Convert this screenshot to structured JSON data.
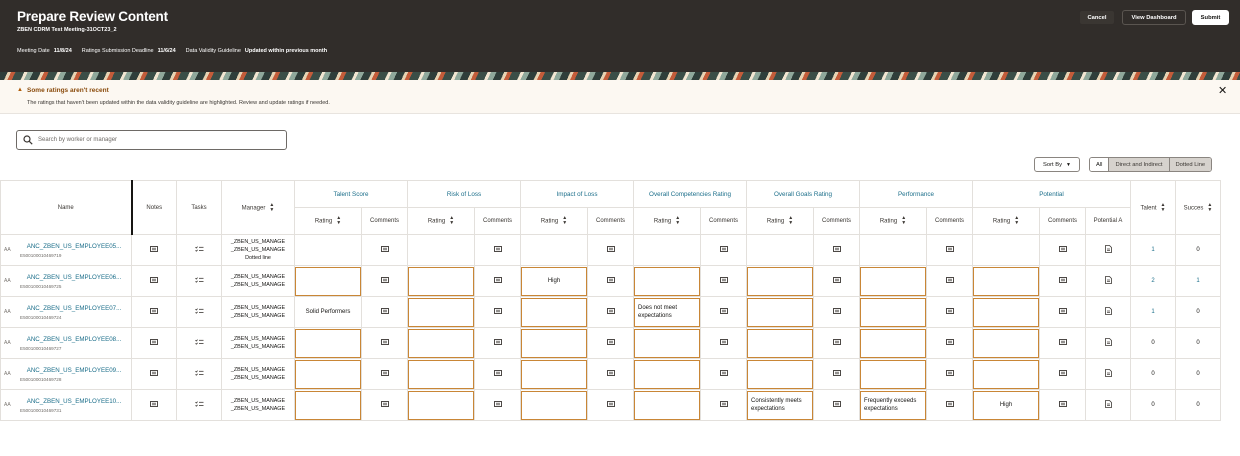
{
  "header": {
    "title": "Prepare Review Content",
    "subtitle": "ZBEN CDRM Test Meeting-31OCT23_2",
    "meeting_date_label": "Meeting Date",
    "meeting_date": "11/8/24",
    "deadline_label": "Ratings Submission Deadline",
    "deadline": "11/6/24",
    "validity_label": "Data Validity Guideline",
    "validity": "Updated within previous month",
    "cancel_label": "Cancel",
    "dashboard_label": "View Dashboard",
    "submit_label": "Submit"
  },
  "alert": {
    "title": "Some ratings aren't recent",
    "message": "The ratings that haven't been updated within the data validity guideline are highlighted. Review and update ratings if needed."
  },
  "search": {
    "placeholder": "Search by worker or manager"
  },
  "toolbar": {
    "sort_label": "Sort By",
    "filters": [
      "All",
      "Direct and Indirect",
      "Dotted Line"
    ]
  },
  "columns": {
    "name": "Name",
    "notes": "Notes",
    "tasks": "Tasks",
    "manager": "Manager",
    "groups": [
      "Talent Score",
      "Risk of Loss",
      "Impact of Loss",
      "Overall Competencies Rating",
      "Overall Goals Rating",
      "Performance",
      "Potential"
    ],
    "rating": "Rating",
    "comments": "Comments",
    "potential_a": "Potential A",
    "talent": "Talent",
    "success": "Succes"
  },
  "rows": [
    {
      "aa": "AA",
      "name": "ANC_ZBEN_US_EMPLOYEE05...",
      "id": "E50010001046​9719",
      "mgr1": "_ZBEN_US_MANAGE",
      "mgr2": "_ZBEN_US_MANAGE",
      "mgr3": "Dotted line",
      "ratings": [
        "",
        "",
        "",
        "",
        "",
        "",
        ""
      ],
      "flag": [
        false,
        false,
        false,
        false,
        false,
        false,
        false
      ],
      "talent": "1",
      "success": "0"
    },
    {
      "aa": "AA",
      "name": "ANC_ZBEN_US_EMPLOYEE06...",
      "id": "E500100010469725",
      "mgr1": "_ZBEN_US_MANAGE",
      "mgr2": "_ZBEN_US_MANAGE",
      "mgr3": "",
      "ratings": [
        "",
        "",
        "High",
        "",
        "",
        "",
        ""
      ],
      "flag": [
        true,
        true,
        true,
        true,
        true,
        true,
        true
      ],
      "talent": "2",
      "success": "1"
    },
    {
      "aa": "AA",
      "name": "ANC_ZBEN_US_EMPLOYEE07...",
      "id": "E500100010469724",
      "mgr1": "_ZBEN_US_MANAGE",
      "mgr2": "_ZBEN_US_MANAGE",
      "mgr3": "",
      "ratings": [
        "Solid Performers",
        "",
        "",
        "Does not meet expectations",
        "",
        "",
        ""
      ],
      "flag": [
        false,
        true,
        true,
        true,
        true,
        true,
        true
      ],
      "talent": "1",
      "success": "0"
    },
    {
      "aa": "AA",
      "name": "ANC_ZBEN_US_EMPLOYEE08...",
      "id": "E500100010469727",
      "mgr1": "_ZBEN_US_MANAGE",
      "mgr2": "_ZBEN_US_MANAGE",
      "mgr3": "",
      "ratings": [
        "",
        "",
        "",
        "",
        "",
        "",
        ""
      ],
      "flag": [
        true,
        true,
        true,
        true,
        true,
        true,
        true
      ],
      "talent": "0",
      "success": "0"
    },
    {
      "aa": "AA",
      "name": "ANC_ZBEN_US_EMPLOYEE09...",
      "id": "E500100010469728",
      "mgr1": "_ZBEN_US_MANAGE",
      "mgr2": "_ZBEN_US_MANAGE",
      "mgr3": "",
      "ratings": [
        "",
        "",
        "",
        "",
        "",
        "",
        ""
      ],
      "flag": [
        true,
        true,
        true,
        true,
        true,
        true,
        true
      ],
      "talent": "0",
      "success": "0"
    },
    {
      "aa": "AA",
      "name": "ANC_ZBEN_US_EMPLOYEE10...",
      "id": "E500100010469731",
      "mgr1": "_ZBEN_US_MANAGE",
      "mgr2": "_ZBEN_US_MANAGE",
      "mgr3": "",
      "ratings": [
        "",
        "",
        "",
        "",
        "Consistently meets expectations",
        "Frequently exceeds expectations",
        "High"
      ],
      "flag": [
        true,
        true,
        true,
        true,
        true,
        true,
        true
      ],
      "talent": "0",
      "success": "0"
    }
  ],
  "icons": {
    "notes": "comment-icon",
    "tasks": "checklist-icon",
    "comments": "comment-icon",
    "potential_a": "document-edit-icon"
  },
  "colors": {
    "header_bg": "#312d2a",
    "link": "#1b6e8a",
    "highlight_border": "#c98636",
    "alert_bg": "#fcf8f2"
  }
}
